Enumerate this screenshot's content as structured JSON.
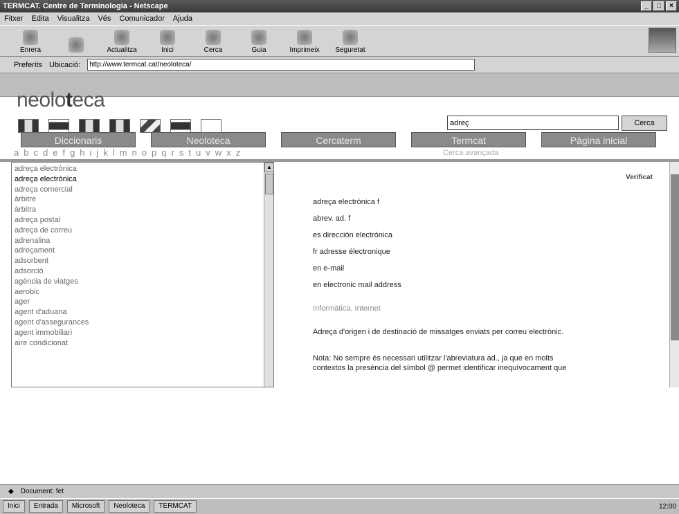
{
  "window": {
    "title": "TERMCAT. Centre de Terminologia - Netscape"
  },
  "menu": [
    "Fitxer",
    "Edita",
    "Visualitza",
    "Vés",
    "Comunicador",
    "Ajuda"
  ],
  "toolbar": [
    "Enrera",
    "",
    "Actualitza",
    "Inici",
    "Cerca",
    "Guia",
    "Imprimeix",
    "Seguretat"
  ],
  "location": {
    "bookmarks": "Preferits",
    "label": "Ubicació:",
    "url": "http://www.termcat.cat/neoloteca/"
  },
  "nav": [
    "Diccionaris",
    "Neoloteca",
    "Cercaterm",
    "Termcat",
    "Pàgina inicial"
  ],
  "brand": {
    "prefix": "neolo",
    "bold": "t",
    "suffix": "eca"
  },
  "search": {
    "value": "adreç",
    "button": "Cerca"
  },
  "alphabet": [
    "a",
    "b",
    "c",
    "d",
    "e",
    "f",
    "g",
    "h",
    "i",
    "j",
    "k",
    "l",
    "m",
    "n",
    "o",
    "p",
    "q",
    "r",
    "s",
    "t",
    "u",
    "v",
    "w",
    "x",
    "z"
  ],
  "alpha_extra": "Cerca avançada",
  "list": [
    "adreça electrònica",
    "adreça electrònica",
    "adreça comercial",
    "àrbitre",
    "àrbitra",
    "adreça postal",
    "adreça de correu",
    "adrenalina",
    "adreçament",
    "adsorbent",
    "adsorció",
    "agència de viatges",
    "aerobic",
    "ager",
    "agent d'aduana",
    "agent d'assegurances",
    "agent immobiliari",
    "aire condicionat"
  ],
  "entry": {
    "verified": "Verificat",
    "term": "adreça electrònica f",
    "abbr": "abrev. ad. f",
    "es": "es  dirección electrónica",
    "fr": "fr  adresse électronique",
    "en1": "en  e-mail",
    "en2": "en  electronic mail address",
    "field": "Informàtica. Internet",
    "definition": "Adreça d'origen i de destinació de missatges enviats per correu electrònic.",
    "note1": "Nota: No sempre és necessari utilitzar l'abreviatura ad., ja que en molts",
    "note2": "contextos la presència del símbol @ permet identificar inequívocament que"
  },
  "status": {
    "text": "Document: fet"
  },
  "taskbar": [
    "Inici",
    "Entrada",
    "Microsoft",
    "Neoloteca",
    "TERMCAT"
  ],
  "clock": "12:00"
}
